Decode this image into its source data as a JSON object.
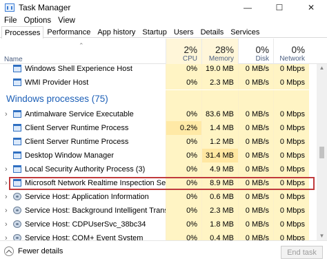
{
  "window": {
    "title": "Task Manager",
    "controls": [
      "—",
      "☐",
      "✕"
    ]
  },
  "menu": [
    "File",
    "Options",
    "View"
  ],
  "tabs": [
    "Processes",
    "Performance",
    "App history",
    "Startup",
    "Users",
    "Details",
    "Services"
  ],
  "columns": {
    "name": "Name",
    "cpu": {
      "pct": "2%",
      "label": "CPU"
    },
    "memory": {
      "pct": "28%",
      "label": "Memory"
    },
    "disk": {
      "pct": "0%",
      "label": "Disk"
    },
    "network": {
      "pct": "0%",
      "label": "Network"
    }
  },
  "top_rows": [
    {
      "name": "Windows Shell Experience Host",
      "cpu": "0%",
      "memory": "19.0 MB",
      "disk": "0 MB/s",
      "network": "0 Mbps"
    },
    {
      "name": "WMI Provider Host",
      "cpu": "0%",
      "memory": "2.3 MB",
      "disk": "0 MB/s",
      "network": "0 Mbps"
    }
  ],
  "group_title": "Windows processes (75)",
  "rows": [
    {
      "name": "Antimalware Service Executable",
      "cpu": "0%",
      "memory": "83.6 MB",
      "disk": "0 MB/s",
      "network": "0 Mbps"
    },
    {
      "name": "Client Server Runtime Process",
      "cpu": "0.2%",
      "memory": "1.4 MB",
      "disk": "0 MB/s",
      "network": "0 Mbps"
    },
    {
      "name": "Client Server Runtime Process",
      "cpu": "0%",
      "memory": "1.2 MB",
      "disk": "0 MB/s",
      "network": "0 Mbps"
    },
    {
      "name": "Desktop Window Manager",
      "cpu": "0%",
      "memory": "31.4 MB",
      "disk": "0 MB/s",
      "network": "0 Mbps"
    },
    {
      "name": "Local Security Authority Process (3)",
      "cpu": "0%",
      "memory": "4.9 MB",
      "disk": "0 MB/s",
      "network": "0 Mbps"
    },
    {
      "name": "Microsoft Network Realtime Inspection Service",
      "cpu": "0%",
      "memory": "8.9 MB",
      "disk": "0 MB/s",
      "network": "0 Mbps"
    },
    {
      "name": "Service Host: Application Information",
      "cpu": "0%",
      "memory": "0.6 MB",
      "disk": "0 MB/s",
      "network": "0 Mbps"
    },
    {
      "name": "Service Host: Background Intelligent Transfer Service",
      "cpu": "0%",
      "memory": "2.3 MB",
      "disk": "0 MB/s",
      "network": "0 Mbps"
    },
    {
      "name": "Service Host: CDPUserSvc_38bc34",
      "cpu": "0%",
      "memory": "1.8 MB",
      "disk": "0 MB/s",
      "network": "0 Mbps"
    },
    {
      "name": "Service Host: COM+ Event System",
      "cpu": "0%",
      "memory": "0.4 MB",
      "disk": "0 MB/s",
      "network": "0 Mbps"
    }
  ],
  "footer": {
    "fewer_details": "Fewer details",
    "end_task": "End task"
  }
}
